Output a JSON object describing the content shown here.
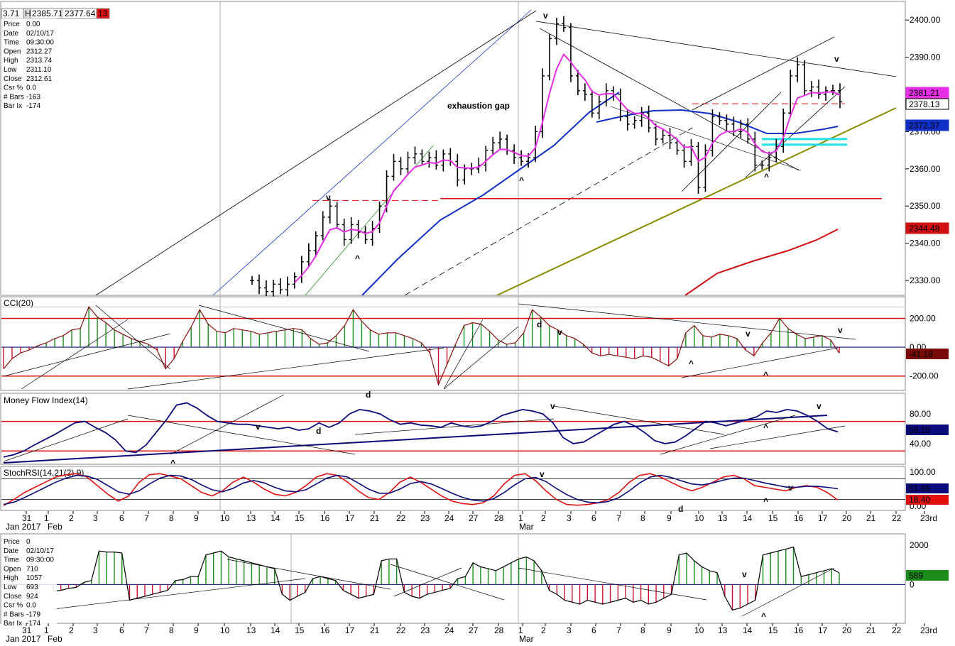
{
  "header": {
    "fields": [
      "3.71",
      "H",
      "2385.71",
      "2377.64",
      "13"
    ]
  },
  "info_panel_top": {
    "rows": [
      [
        "Price",
        "0.00"
      ],
      [
        "Date",
        "02/10/17"
      ],
      [
        "Time",
        "09:30:00"
      ],
      [
        "Open",
        "2312.27"
      ],
      [
        "High",
        "2313.74"
      ],
      [
        "Low",
        "2311.10"
      ],
      [
        "Close",
        "2312.61"
      ],
      [
        "Csr %",
        "0.0"
      ],
      [
        "# Bars",
        "-163"
      ],
      [
        "Bar Ix",
        "-174"
      ]
    ]
  },
  "info_panel_bottom": {
    "rows": [
      [
        "Price",
        "0"
      ],
      [
        "Date",
        "02/10/17"
      ],
      [
        "Time",
        "09:30:00"
      ],
      [
        "Open",
        "710"
      ],
      [
        "High",
        "1057"
      ],
      [
        "Low",
        "693"
      ],
      [
        "Close",
        "924"
      ],
      [
        "Csr %",
        "0.0"
      ],
      [
        "# Bars",
        "-179"
      ],
      [
        "Bar Ix",
        "-174"
      ]
    ]
  },
  "colors": {
    "ma_magenta": "#e62ee6",
    "ma_blue": "#1030c8",
    "ma_red": "#d01010",
    "trend_olive": "#8a8a00",
    "cyan": "#22e0e8",
    "hist_up": "#1a8c1a",
    "hist_down": "#c8102e",
    "navy": "#0a0a7a",
    "red_line": "#e01010"
  },
  "chart_data": [
    {
      "type": "ohlc",
      "name": "price",
      "y_ticks": [
        "2330.00",
        "2340.00",
        "2350.00",
        "2360.00",
        "2370.00",
        "2380.00",
        "2390.00",
        "2400.00"
      ],
      "ylim": [
        2326,
        2405
      ],
      "annotations": [
        "exhaustion gap",
        "v",
        "^",
        "v",
        "^",
        "^",
        "v"
      ],
      "price_labels": [
        {
          "text": "2381.21",
          "kind": "magenta"
        },
        {
          "text": "2378.13",
          "kind": "black"
        },
        {
          "text": "2372.37",
          "kind": "blue"
        },
        {
          "text": "2344.48",
          "kind": "red"
        }
      ],
      "support_level": 2352,
      "dashed_resistance_1": 2351.5,
      "dashed_resistance_2": 2377.5,
      "cyan_levels": [
        2368,
        2366.5
      ],
      "closes": [
        2330,
        2328,
        2327,
        2329,
        2327.5,
        2329,
        2331,
        2335,
        2338,
        2342,
        2347,
        2350,
        2345,
        2341,
        2345,
        2343,
        2341,
        2344,
        2350,
        2358,
        2362,
        2360,
        2363,
        2364,
        2362,
        2363,
        2361,
        2364,
        2362,
        2357,
        2360,
        2360,
        2361,
        2365,
        2367,
        2368,
        2365,
        2363,
        2362,
        2363,
        2370,
        2385,
        2395,
        2399,
        2398,
        2385,
        2381,
        2380,
        2375,
        2378,
        2381,
        2380,
        2374,
        2372,
        2373,
        2375,
        2371,
        2368,
        2369,
        2367,
        2365,
        2362,
        2366,
        2355,
        2365,
        2374,
        2373,
        2372,
        2370,
        2372,
        2368,
        2361,
        2361,
        2363,
        2366,
        2375,
        2385,
        2388,
        2381,
        2382,
        2380,
        2381,
        2381,
        2378
      ]
    },
    {
      "type": "histogram",
      "name": "CCI(20)",
      "y_ticks": [
        "200.00",
        "0.00",
        "-200.00"
      ],
      "ylim": [
        -290,
        340
      ],
      "value_label": "-41.18",
      "annotations": [
        "d",
        "v",
        "^",
        "v",
        "^",
        "v"
      ],
      "values": [
        -150,
        -80,
        -40,
        -20,
        10,
        30,
        60,
        80,
        120,
        130,
        280,
        210,
        170,
        120,
        90,
        60,
        40,
        20,
        -20,
        -150,
        -80,
        40,
        140,
        260,
        160,
        110,
        100,
        130,
        120,
        110,
        90,
        100,
        110,
        120,
        130,
        120,
        60,
        20,
        30,
        80,
        150,
        260,
        180,
        120,
        90,
        100,
        100,
        80,
        60,
        30,
        -40,
        -260,
        -120,
        20,
        150,
        170,
        160,
        110,
        50,
        20,
        30,
        100,
        260,
        210,
        150,
        120,
        80,
        60,
        20,
        -40,
        -60,
        -50,
        -60,
        -70,
        -80,
        -60,
        -70,
        -100,
        -130,
        -80,
        100,
        150,
        80,
        70,
        90,
        80,
        60,
        -20,
        -60,
        30,
        100,
        200,
        130,
        90,
        60,
        70,
        80,
        50,
        -41
      ]
    },
    {
      "type": "line",
      "name": "Money Flow Index(14)",
      "y_ticks": [
        "80.00",
        "60.00",
        "40.00"
      ],
      "ylim": [
        14,
        106
      ],
      "value_label": "56.10",
      "annotations": [
        "v",
        "d",
        "d",
        "v",
        "v",
        "^",
        "^"
      ],
      "series": [
        {
          "name": "",
          "values": [
            22,
            25,
            30,
            38,
            45,
            52,
            60,
            68,
            70,
            62,
            55,
            45,
            30,
            28,
            38,
            55,
            72,
            92,
            95,
            88,
            78,
            70,
            68,
            66,
            66,
            64,
            62,
            60,
            62,
            58,
            60,
            68,
            62,
            68,
            80,
            86,
            84,
            80,
            72,
            66,
            68,
            65,
            64,
            62,
            68,
            64,
            62,
            64,
            70,
            78,
            82,
            86,
            84,
            80,
            68,
            48,
            40,
            42,
            50,
            58,
            66,
            70,
            64,
            55,
            44,
            40,
            42,
            50,
            60,
            70,
            68,
            64,
            68,
            72,
            76,
            84,
            82,
            86,
            84,
            78,
            70,
            60,
            56
          ]
        }
      ]
    },
    {
      "type": "line",
      "name": "StochRSI(14,21(2),9)",
      "y_ticks": [
        "100.00",
        "0.00"
      ],
      "ylim": [
        -8,
        112
      ],
      "value_labels": [
        "51.06",
        "18.40"
      ],
      "annotations": [
        "v",
        "d",
        "v",
        "^",
        "^"
      ],
      "series": [
        {
          "name": "",
          "values": [
            2,
            20,
            40,
            55,
            70,
            85,
            92,
            95,
            85,
            60,
            35,
            15,
            30,
            70,
            92,
            95,
            88,
            80,
            60,
            40,
            30,
            45,
            70,
            85,
            70,
            50,
            35,
            30,
            40,
            60,
            85,
            95,
            90,
            70,
            45,
            25,
            20,
            40,
            70,
            85,
            70,
            50,
            30,
            15,
            8,
            5,
            10,
            30,
            65,
            90,
            95,
            75,
            45,
            20,
            5,
            3,
            5,
            10,
            20,
            40,
            70,
            90,
            95,
            85,
            70,
            55,
            45,
            55,
            70,
            85,
            90,
            80,
            60,
            55,
            50,
            45,
            55,
            60,
            55,
            40,
            18
          ]
        },
        {
          "name": "",
          "values": [
            5,
            12,
            25,
            40,
            55,
            70,
            82,
            90,
            88,
            78,
            60,
            42,
            35,
            45,
            65,
            82,
            90,
            88,
            78,
            62,
            48,
            42,
            52,
            68,
            75,
            68,
            55,
            45,
            42,
            48,
            65,
            82,
            90,
            85,
            68,
            50,
            38,
            38,
            50,
            66,
            72,
            65,
            52,
            38,
            26,
            18,
            15,
            22,
            40,
            62,
            80,
            84,
            72,
            52,
            34,
            20,
            12,
            10,
            14,
            25,
            45,
            68,
            85,
            90,
            84,
            74,
            65,
            62,
            68,
            76,
            82,
            82,
            75,
            68,
            62,
            56,
            55,
            58,
            58,
            55,
            51
          ]
        }
      ]
    },
    {
      "type": "histogram",
      "name": "",
      "y_ticks": [
        "2000",
        "0"
      ],
      "ylim": [
        -1900,
        2500
      ],
      "value_label": "589",
      "annotations": [
        "v",
        "^"
      ],
      "values": [
        -350,
        -300,
        -200,
        -150,
        100,
        200,
        1700,
        1650,
        1650,
        1600,
        -800,
        -700,
        -600,
        -500,
        -400,
        -300,
        200,
        250,
        400,
        400,
        1500,
        1600,
        1700,
        1400,
        1300,
        1200,
        1100,
        1000,
        900,
        800,
        -500,
        -800,
        -600,
        -400,
        300,
        400,
        300,
        200,
        -300,
        -500,
        -700,
        -600,
        -500,
        1200,
        1300,
        1300,
        -400,
        -600,
        -700,
        -500,
        -400,
        -300,
        -200,
        300,
        400,
        1100,
        900,
        800,
        700,
        900,
        1100,
        1300,
        1400,
        1200,
        700,
        -300,
        -500,
        -800,
        -900,
        -1000,
        -800,
        -900,
        -1000,
        -900,
        -800,
        -700,
        -900,
        -800,
        -1000,
        -900,
        -700,
        -500,
        1500,
        1600,
        1200,
        900,
        700,
        600,
        -600,
        -1300,
        -1200,
        -1000,
        -800,
        1500,
        1600,
        1700,
        1800,
        1900,
        400,
        500,
        600,
        700,
        800,
        589
      ]
    }
  ],
  "x_axis": {
    "labels": [
      "31",
      "1",
      "2",
      "3",
      "6",
      "7",
      "8",
      "9",
      "10",
      "13",
      "14",
      "15",
      "16",
      "17",
      "21",
      "22",
      "23",
      "24",
      "27",
      "28",
      "1",
      "2",
      "3",
      "6",
      "7",
      "8",
      "9",
      "10",
      "13",
      "14",
      "15",
      "16",
      "17",
      "20",
      "21",
      "22",
      "23rd"
    ],
    "months": [
      "Jan 2017",
      "Feb",
      "Mar"
    ]
  }
}
